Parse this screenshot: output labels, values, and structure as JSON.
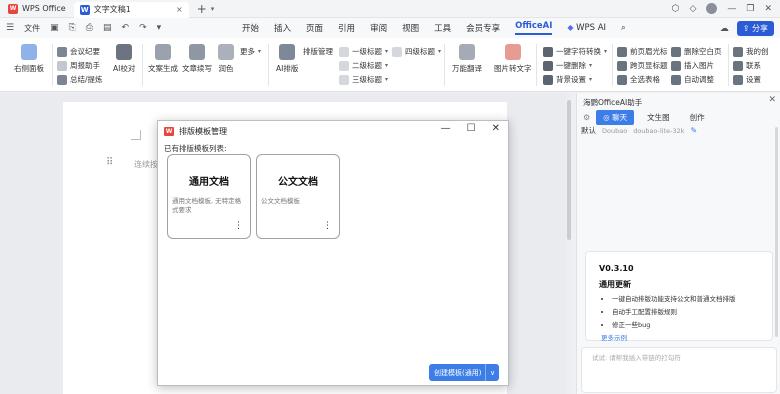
{
  "titlebar": {
    "app_name": "WPS Office",
    "doc_tab": "文字文稿1",
    "close": "×",
    "plus": "+",
    "dropdown": "▾"
  },
  "menubar": {
    "file": "文件",
    "tabs": [
      "开始",
      "插入",
      "页面",
      "引用",
      "审阅",
      "视图",
      "工具",
      "会员专享",
      "OfficeAI",
      "WPS AI"
    ],
    "active_tab": "OfficeAI",
    "share": "分享"
  },
  "ribbon": {
    "right_panel": "右侧面板",
    "meeting_minutes": "会议纪要",
    "weekly_report": "周报助手",
    "summary": "总结/提炼",
    "ai_proofread": "AI校对",
    "text_gen": "文案生成",
    "continue_write": "文章续写",
    "polish": "润色",
    "more": "更多",
    "ai_layout": "AI排版",
    "layout_mgmt": "排版管理",
    "h1": "一级标题",
    "h2": "二级标题",
    "h3": "三级标题",
    "h4": "四级标题",
    "translate": "万能翻译",
    "img2text": "图片转文字",
    "char_convert": "一键字符转换",
    "one_delete": "一键删除",
    "bg_settings": "背景设置",
    "header_cursor": "前页眉光标",
    "delete_blank": "删除空白页",
    "cross_page_header": "跨页显标题",
    "insert_image": "插入图片",
    "select_table": "全选表格",
    "auto_adjust": "自动调整",
    "my_creations": "我的创",
    "contact": "联系",
    "settings": "设置"
  },
  "document": {
    "text": "连续按"
  },
  "dialog": {
    "title": "排版模板管理",
    "subtitle": "已有排版模板列表:",
    "cards": [
      {
        "title": "通用文档",
        "desc": "通用文档模板, 无特定格式要求",
        "menu": "⋮"
      },
      {
        "title": "公文文档",
        "desc": "公文文档模板",
        "menu": "⋮"
      }
    ],
    "create_button": "创建模板(通用)"
  },
  "panel": {
    "title": "海鹦OfficeAI助手",
    "close": "✕",
    "tabs": [
      "聊天",
      "文生图",
      "创作"
    ],
    "active_tab": "聊天",
    "default_label": "默认",
    "model_provider": "Doubao",
    "model_name": "doubao-lite-32k",
    "version": "V0.3.10",
    "update_heading": "通用更新",
    "updates": [
      "一键自动排版功能支持公文和普通文档排版",
      "自动手工配置排版规则",
      "修正一些bug"
    ],
    "more_examples": "更多示例",
    "input_placeholder": "试试: 请帮我插入带链的打勾符"
  }
}
